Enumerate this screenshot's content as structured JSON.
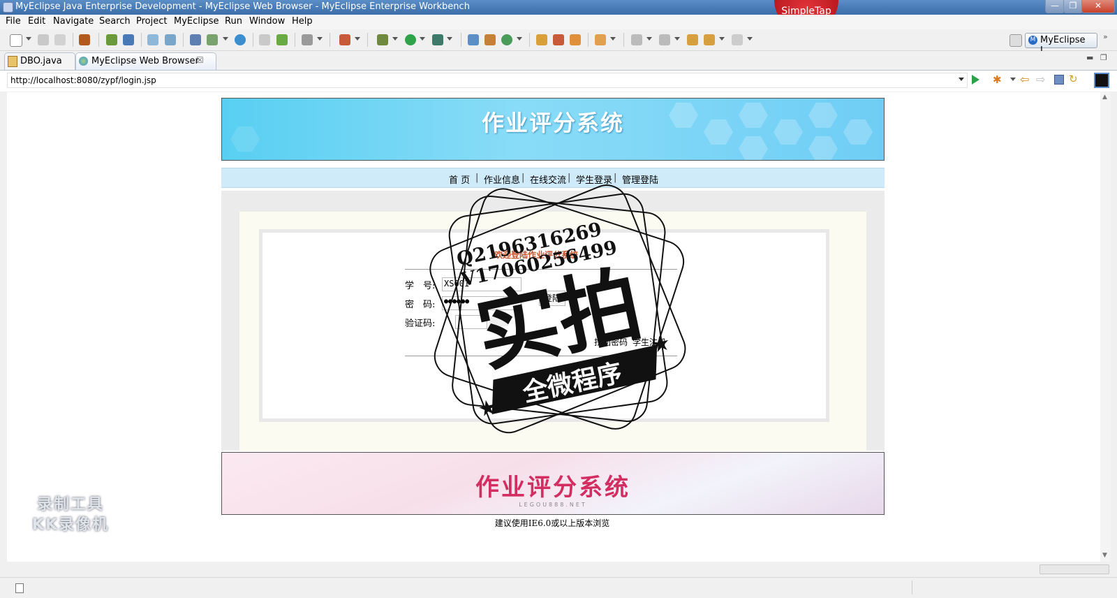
{
  "window": {
    "title": "MyEclipse Java Enterprise Development - MyEclipse Web Browser - MyEclipse Enterprise Workbench",
    "simpletap_label": "SimpleTap"
  },
  "menu": [
    "File",
    "Edit",
    "Navigate",
    "Search",
    "Project",
    "MyEclipse",
    "Run",
    "Window",
    "Help"
  ],
  "perspective": {
    "label": "MyEclipse J...",
    "icon": "myeclipse-icon"
  },
  "tabs": [
    {
      "label": "DBO.java",
      "icon": "java-file-icon",
      "active": false
    },
    {
      "label": "MyEclipse Web Browser",
      "icon": "globe-icon",
      "active": true
    }
  ],
  "address": {
    "url": "http://localhost:8080/zypf/login.jsp"
  },
  "page": {
    "banner_title": "作业评分系统",
    "nav": [
      "首 页",
      "作业信息",
      "在线交流",
      "学生登录",
      "管理登陆"
    ],
    "login": {
      "welcome": "欢迎登陆作业评分系统",
      "student_id_label": "学　号:",
      "student_id_value": "XS001",
      "password_label": "密　码:",
      "password_value": "●●●●●●",
      "captcha_label": "验证码:",
      "login_button": "登陆",
      "forgot_password": "找回密码",
      "register": "学生注册"
    },
    "footer_title": "作业评分系统",
    "footer_sub": "LEGOU888.NET",
    "notice": "建议使用IE6.0或以上版本浏览"
  },
  "watermark": {
    "line1": "Q2196316269",
    "line2": "V17060256499",
    "big": "实拍",
    "ribbon": "全微程序",
    "recorder_line1": "录制工具",
    "recorder_line2": "KK录像机"
  },
  "colors": {
    "banner": "#58cff2",
    "nav_bg": "#cfeaf8",
    "footer_title": "#d22e62",
    "welcome": "#c8502a",
    "simpletap": "#d1222a"
  }
}
